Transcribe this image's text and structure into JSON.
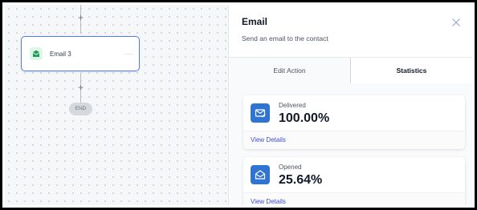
{
  "canvas": {
    "node": {
      "label": "Email 3",
      "menu": "···",
      "icon": "email-icon"
    },
    "plus_symbol": "+",
    "end_label": "END"
  },
  "panel": {
    "title": "Email",
    "subtitle": "Send an email to the contact",
    "close_icon": "close-icon",
    "tabs": [
      {
        "label": "Edit Action",
        "active": false
      },
      {
        "label": "Statistics",
        "active": true
      }
    ],
    "stats": [
      {
        "label": "Delivered",
        "value": "100.00%",
        "link": "View Details",
        "icon": "delivered-mail-icon"
      },
      {
        "label": "Opened",
        "value": "25.64%",
        "link": "View Details",
        "icon": "opened-mail-icon"
      }
    ]
  },
  "colors": {
    "accent_blue": "#2f74d0",
    "node_border": "#4f7cf0",
    "link": "#3b4bd6",
    "node_icon_bg": "#dff5e7",
    "node_icon": "#1f9d55"
  }
}
